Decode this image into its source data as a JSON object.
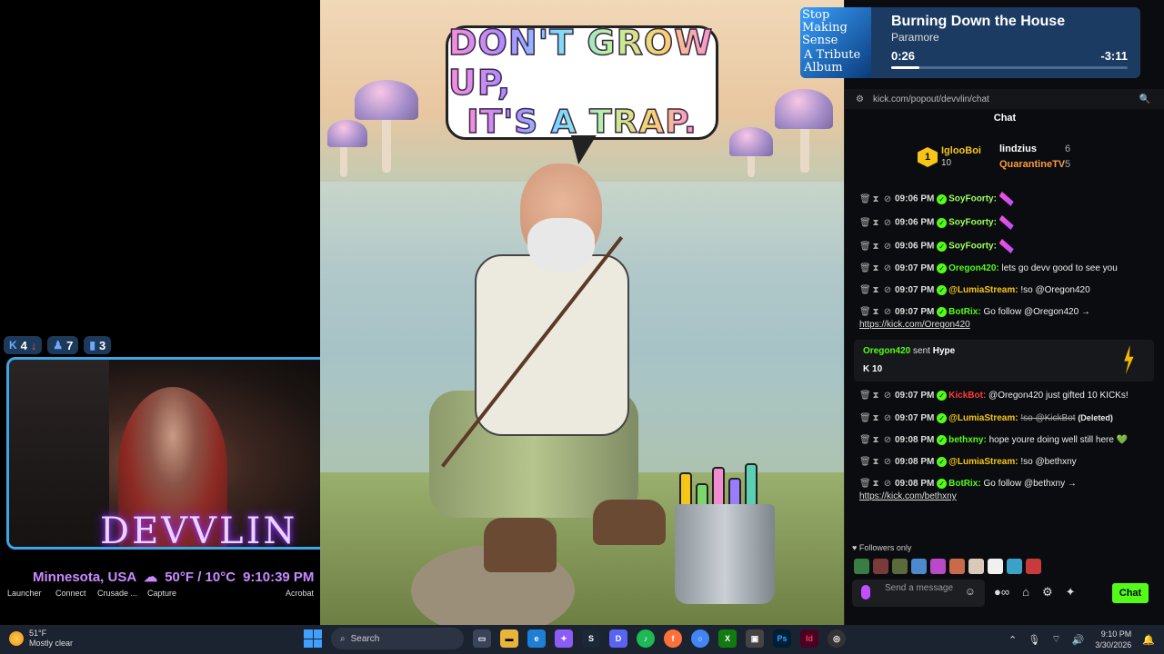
{
  "overlay": {
    "stats": [
      {
        "icon": "kick-icon",
        "value": "4",
        "trend": "↓"
      },
      {
        "icon": "person-icon",
        "value": "7"
      },
      {
        "icon": "bars-icon",
        "value": "3"
      }
    ],
    "logo_text": "DEVVLIN",
    "weather_location": "Minnesota, USA",
    "weather_temp": "50°F / 10°C",
    "weather_time": "9:10:39 PM"
  },
  "desktop_icons": [
    "Launcher",
    "Connect",
    "Crusade ...",
    "Capture",
    "Acrobat"
  ],
  "art": {
    "line1": "DON'T GROW UP,",
    "line2": "IT'S A TRAP."
  },
  "now_playing": {
    "album_line1": "Stop Making Sense",
    "album_line2": "A Tribute Album",
    "title": "Burning Down the House",
    "artist": "Paramore",
    "elapsed": "0:26",
    "remaining": "-3:11",
    "progress_fraction": 0.12
  },
  "browser": {
    "url": "kick.com/popout/devvlin/chat"
  },
  "chat": {
    "title": "Chat",
    "leaderboard": {
      "first_rank": "1",
      "first_name": "IglooBoi",
      "first_count": "10",
      "second_name": "lindzius",
      "second_count": "6",
      "third_name": "QuarantineTV",
      "third_count": "5"
    },
    "messages": [
      {
        "time": "09:06 PM",
        "user": "SoyFoorty:",
        "color": "#9cff5c",
        "body": "",
        "emote": true
      },
      {
        "time": "09:06 PM",
        "user": "SoyFoorty:",
        "color": "#9cff5c",
        "body": "",
        "emote": true
      },
      {
        "time": "09:06 PM",
        "user": "SoyFoorty:",
        "color": "#9cff5c",
        "body": "",
        "emote": true
      },
      {
        "time": "09:07 PM",
        "user": "Oregon420:",
        "color": "#53fc18",
        "body": "lets go devv good to see you"
      },
      {
        "time": "09:07 PM",
        "user": "@LumiaStream:",
        "color": "#f5c518",
        "body": "!so @Oregon420"
      },
      {
        "time": "09:07 PM",
        "user": "BotRix:",
        "color": "#53fc18",
        "body": "Go follow @Oregon420 →",
        "link": "https://kick.com/Oregon420"
      }
    ],
    "gift": {
      "name": "Oregon420",
      "text": "sent",
      "item": "Hype",
      "amount": "10"
    },
    "messages2": [
      {
        "time": "09:07 PM",
        "user": "KickBot:",
        "color": "#ff3b3b",
        "body": "@Oregon420 just gifted 10 KICKs!"
      },
      {
        "time": "09:07 PM",
        "user": "@LumiaStream:",
        "color": "#f5c518",
        "body": "!so @KickBot",
        "deleted": "(Deleted)"
      },
      {
        "time": "09:08 PM",
        "user": "bethxny:",
        "color": "#53fc18",
        "body": "hope youre doing well still here 💚"
      },
      {
        "time": "09:08 PM",
        "user": "@LumiaStream:",
        "color": "#f5c518",
        "body": "!so @bethxny"
      },
      {
        "time": "09:08 PM",
        "user": "BotRix:",
        "color": "#53fc18",
        "body": "Go follow @bethxny →",
        "link": "https://kick.com/bethxny"
      }
    ],
    "followers_only": "Followers only",
    "input_placeholder": "Send a message",
    "send_label": "Chat"
  },
  "taskbar": {
    "weather_temp": "51°F",
    "weather_desc": "Mostly clear",
    "search_placeholder": "Search",
    "clock_time": "9:10 PM",
    "clock_date": "3/30/2026"
  }
}
